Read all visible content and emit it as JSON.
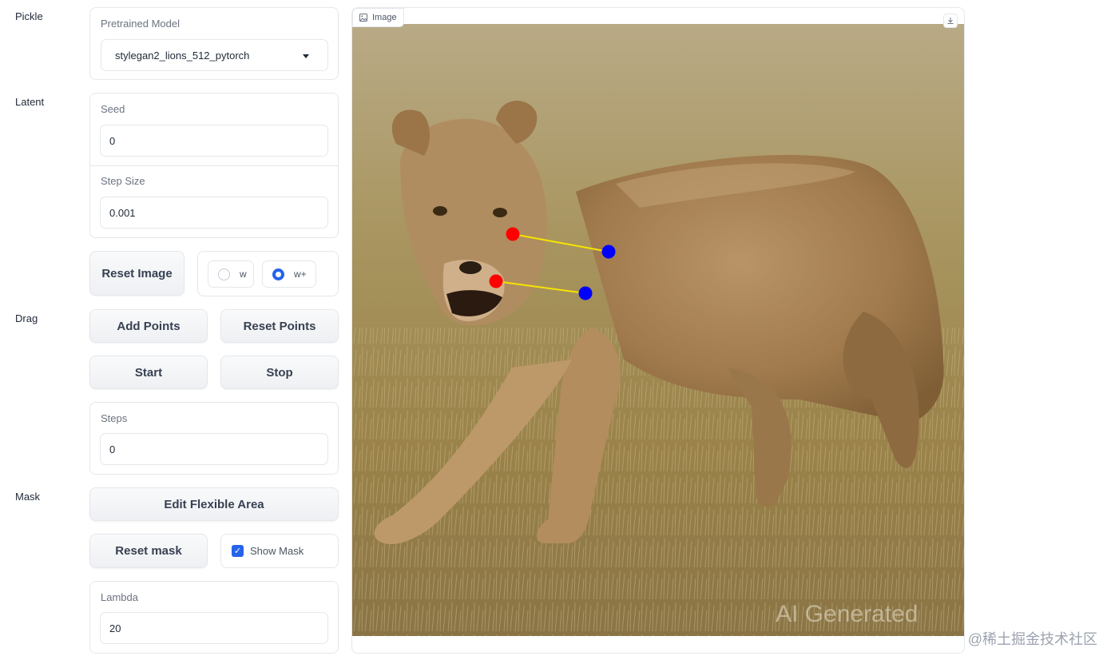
{
  "sections": {
    "pickle": "Pickle",
    "latent": "Latent",
    "drag": "Drag",
    "mask": "Mask"
  },
  "pretrained_model": {
    "label": "Pretrained Model",
    "value": "stylegan2_lions_512_pytorch"
  },
  "seed": {
    "label": "Seed",
    "value": "0"
  },
  "step_size": {
    "label": "Step Size",
    "value": "0.001"
  },
  "buttons": {
    "reset_image": "Reset Image",
    "add_points": "Add Points",
    "reset_points": "Reset Points",
    "start": "Start",
    "stop": "Stop",
    "edit_flexible_area": "Edit Flexible Area",
    "reset_mask": "Reset mask"
  },
  "latent_space": {
    "options": [
      "w",
      "w+"
    ],
    "selected": "w+"
  },
  "steps": {
    "label": "Steps",
    "value": "0"
  },
  "show_mask": {
    "label": "Show Mask",
    "checked": true
  },
  "lambda": {
    "label": "Lambda",
    "value": "20"
  },
  "image_panel": {
    "tag": "Image",
    "overlay_text": "AI Generated",
    "handle_color": "#ff0000",
    "target_color": "#0000ff",
    "line_color": "#f5e400"
  },
  "watermark": "@稀土掘金技术社区",
  "colors": {
    "accent": "#2563eb"
  }
}
